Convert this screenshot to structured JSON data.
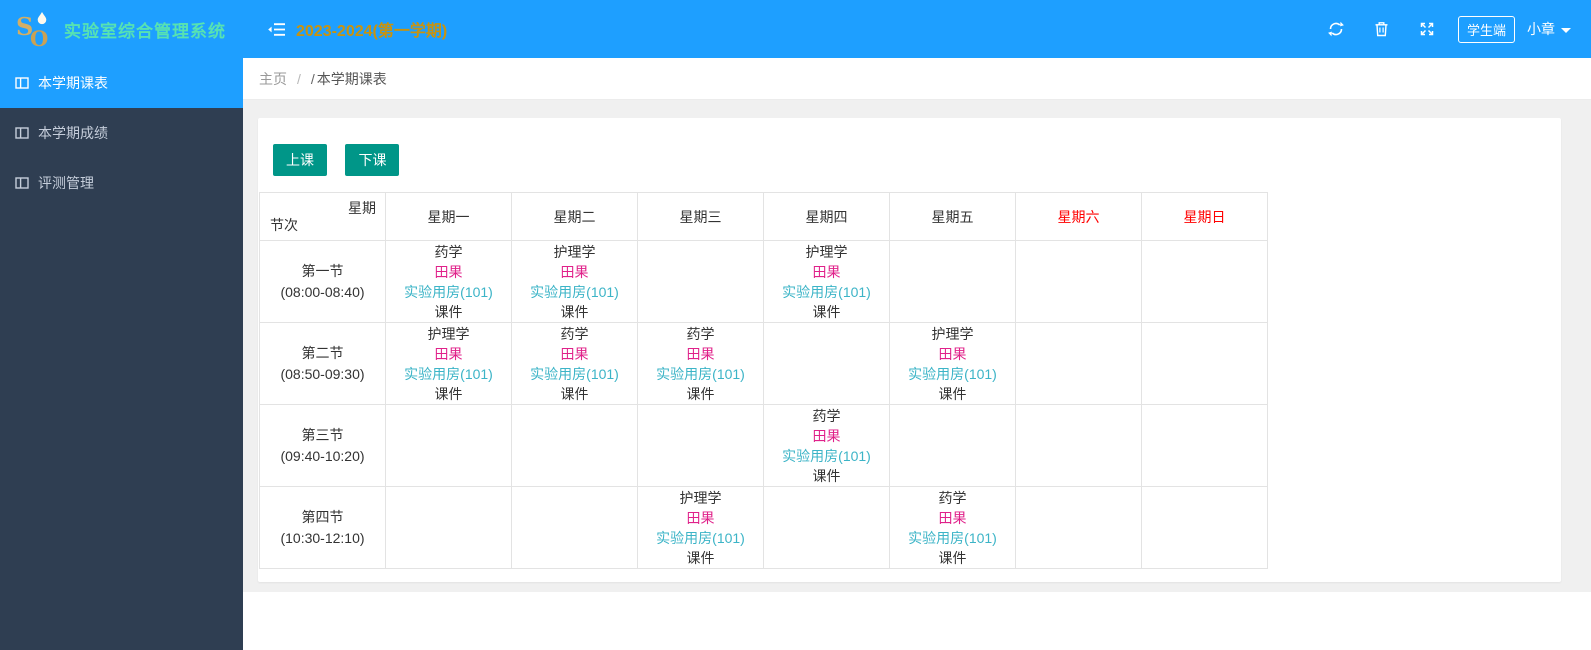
{
  "brand": {
    "title": "实验室综合管理系统"
  },
  "topbar": {
    "term_label": "2023-2024(第一学期)",
    "student_badge": "学生端",
    "username": "小章"
  },
  "sidebar": {
    "items": [
      {
        "label": "本学期课表",
        "active": true
      },
      {
        "label": "本学期成绩",
        "active": false
      },
      {
        "label": "评测管理",
        "active": false
      }
    ]
  },
  "breadcrumb": {
    "home": "主页",
    "separator": "/",
    "current_prefix": "/",
    "current": "本学期课表"
  },
  "toolbar": {
    "begin_class_label": "上课",
    "end_class_label": "下课"
  },
  "timetable": {
    "corner_top": "星期",
    "corner_bottom": "节次",
    "days": [
      {
        "label": "星期一",
        "weekend": false
      },
      {
        "label": "星期二",
        "weekend": false
      },
      {
        "label": "星期三",
        "weekend": false
      },
      {
        "label": "星期四",
        "weekend": false
      },
      {
        "label": "星期五",
        "weekend": false
      },
      {
        "label": "星期六",
        "weekend": true
      },
      {
        "label": "星期日",
        "weekend": true
      }
    ],
    "periods": [
      {
        "name": "第一节",
        "time": "(08:00-08:40)",
        "cells": [
          {
            "course": "药学",
            "teacher": "田果",
            "room": "实验用房(101)",
            "courseware": "课件"
          },
          {
            "course": "护理学",
            "teacher": "田果",
            "room": "实验用房(101)",
            "courseware": "课件"
          },
          null,
          {
            "course": "护理学",
            "teacher": "田果",
            "room": "实验用房(101)",
            "courseware": "课件"
          },
          null,
          null,
          null
        ]
      },
      {
        "name": "第二节",
        "time": "(08:50-09:30)",
        "cells": [
          {
            "course": "护理学",
            "teacher": "田果",
            "room": "实验用房(101)",
            "courseware": "课件"
          },
          {
            "course": "药学",
            "teacher": "田果",
            "room": "实验用房(101)",
            "courseware": "课件"
          },
          {
            "course": "药学",
            "teacher": "田果",
            "room": "实验用房(101)",
            "courseware": "课件"
          },
          null,
          {
            "course": "护理学",
            "teacher": "田果",
            "room": "实验用房(101)",
            "courseware": "课件"
          },
          null,
          null
        ]
      },
      {
        "name": "第三节",
        "time": "(09:40-10:20)",
        "cells": [
          null,
          null,
          null,
          {
            "course": "药学",
            "teacher": "田果",
            "room": "实验用房(101)",
            "courseware": "课件"
          },
          null,
          null,
          null
        ]
      },
      {
        "name": "第四节",
        "time": "(10:30-12:10)",
        "cells": [
          null,
          null,
          {
            "course": "护理学",
            "teacher": "田果",
            "room": "实验用房(101)",
            "courseware": "课件"
          },
          null,
          {
            "course": "药学",
            "teacher": "田果",
            "room": "实验用房(101)",
            "courseware": "课件"
          },
          null,
          null
        ]
      }
    ]
  },
  "theme": {
    "header_blue": "#1E9FFF",
    "sidebar_dark": "#2f3e52",
    "button_teal": "#009688",
    "term_gold": "#c8930f",
    "brand_mint": "#57e2b2",
    "weekend_red": "#ff0000",
    "teacher_magenta": "#e0218a",
    "room_teal": "#3cb4c7"
  }
}
